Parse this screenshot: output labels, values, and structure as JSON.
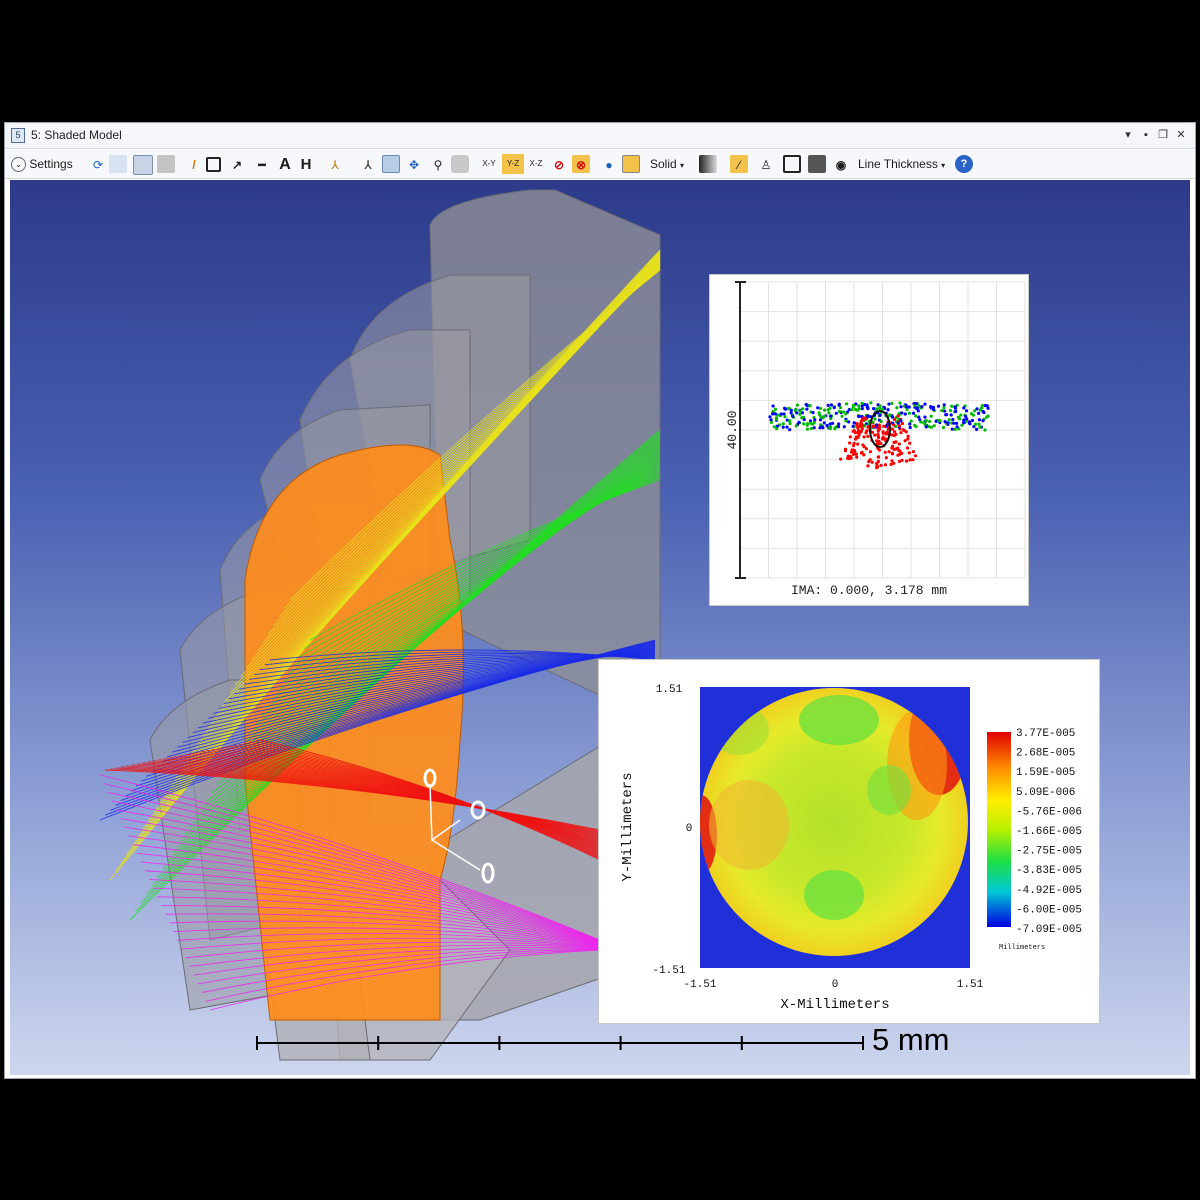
{
  "window": {
    "title": "5: Shaded Model",
    "controls": {
      "dropdown": "▾",
      "pin": "▪",
      "restore": "❐",
      "close": "✕"
    }
  },
  "toolbar": {
    "settings_label": "Settings",
    "view_xy": "X-Y",
    "view_yz": "Y-Z",
    "view_xz": "X-Z",
    "solid_label": "Solid",
    "line_thickness_label": "Line Thickness",
    "help": "?",
    "icons": [
      "refresh-icon",
      "copy-icon",
      "save-icon",
      "print-icon",
      "pencil-icon",
      "rectangle-icon",
      "arrow-line-icon",
      "line-icon",
      "text-icon",
      "dimension-icon",
      "axes-icon",
      "rotate-icon",
      "select-icon",
      "pan-icon",
      "zoom-icon",
      "camera-icon",
      "stop-icon",
      "stop-alt-icon",
      "globe-icon",
      "render-icon",
      "gradient-icon",
      "wand-icon",
      "lock-icon",
      "fit-icon",
      "monitor-icon",
      "record-icon"
    ]
  },
  "spot_diagram": {
    "scale_label": "40.00",
    "field_label": "IMA: 0.000, 3.178 mm",
    "colors": [
      "#ff0000",
      "#00bb00",
      "#0000ff"
    ]
  },
  "opd_map": {
    "x_axis_label": "X-Millimeters",
    "y_axis_label": "Y-Millimeters",
    "x_ticks": [
      "-1.51",
      "0",
      "1.51"
    ],
    "y_ticks": [
      "1.51",
      "0",
      "-1.51"
    ],
    "colorbar_labels": [
      "3.77E-005",
      "2.68E-005",
      "1.59E-005",
      "5.09E-006",
      "-5.76E-006",
      "-1.66E-005",
      "-2.75E-005",
      "-3.83E-005",
      "-4.92E-005",
      "-6.00E-005",
      "-7.09E-005"
    ],
    "colorbar_unit": "Millimeters"
  },
  "scale_bar": {
    "label": "5 mm"
  },
  "rays": {
    "yellow": "#e8e21c",
    "green": "#22dd22",
    "blue": "#1a2ce6",
    "red": "#ee1111",
    "magenta": "#ee22ee"
  },
  "lens_color": "#ff8c1a"
}
